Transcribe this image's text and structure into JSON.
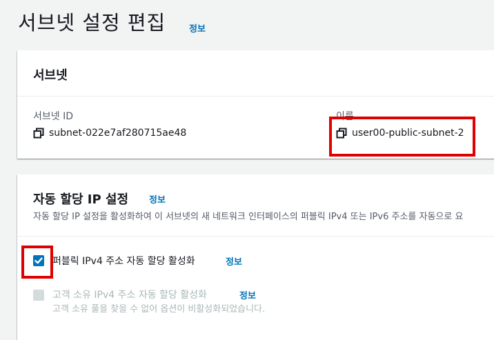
{
  "page": {
    "title": "서브넷 설정 편집",
    "info_link": "정보"
  },
  "subnet_panel": {
    "title": "서브넷",
    "subnet_id_label": "서브넷 ID",
    "subnet_id_value": "subnet-022e7af280715ae48",
    "name_label": "이름",
    "name_value": "user00-public-subnet-2"
  },
  "auto_ip_panel": {
    "title": "자동 할당 IP 설정",
    "info_link": "정보",
    "description": "자동 할당 IP 설정을 활성화하여 이 서브넷의 새 네트워크 인터페이스의 퍼블릭 IPv4 또는 IPv6 주소를 자동으로 요",
    "option_public_ipv4": {
      "label": "퍼블릭 IPv4 주소 자동 할당 활성화",
      "info_link": "정보",
      "checked": true
    },
    "option_customer_ipv4": {
      "label": "고객 소유 IPv4 주소 자동 할당 활성화",
      "info_link": "정보",
      "checked": false,
      "disabled": true,
      "note": "고객 소유 풀을 찾을 수 없어 옵션이 비활성화되었습니다."
    }
  },
  "colors": {
    "link": "#0073bb",
    "highlight": "#e00000",
    "checkbox": "#0073bb"
  },
  "icons": {
    "copy": "copy-icon",
    "check": "check-icon"
  }
}
